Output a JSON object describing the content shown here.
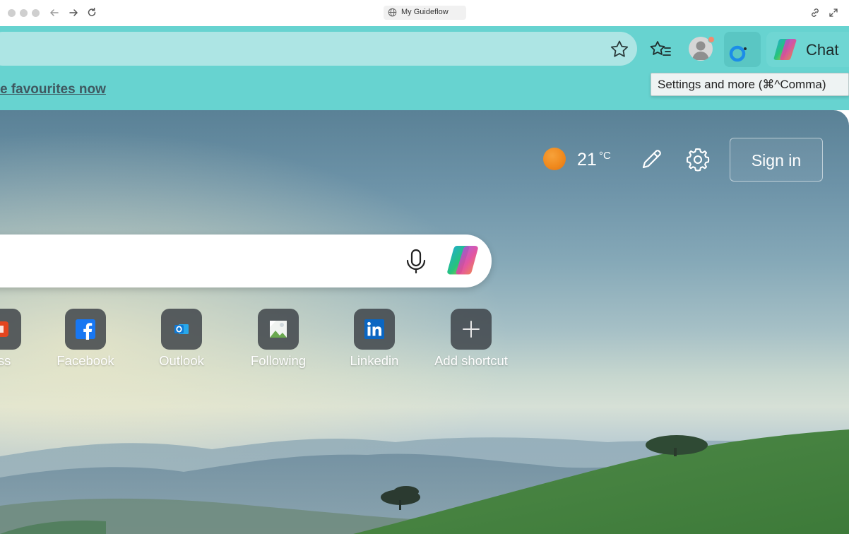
{
  "window": {
    "url_label": "My Guideflow"
  },
  "favourites_bar": {
    "link_text": "e favourites now"
  },
  "toolbar": {
    "chat_label": "Chat",
    "settings_tooltip": "Settings and more (⌘^Comma)"
  },
  "weather": {
    "temperature": "21",
    "unit": "°C"
  },
  "header": {
    "sign_in_label": "Sign in"
  },
  "shortcuts": [
    {
      "label": "ess",
      "icon": "office-icon"
    },
    {
      "label": "Facebook",
      "icon": "facebook-icon"
    },
    {
      "label": "Outlook",
      "icon": "outlook-icon"
    },
    {
      "label": "Following",
      "icon": "image-placeholder-icon"
    },
    {
      "label": "Linkedin",
      "icon": "linkedin-icon"
    },
    {
      "label": "Add shortcut",
      "icon": "plus-icon"
    }
  ],
  "colors": {
    "toolbar_bg": "#67d3d0",
    "address_bg": "#ade5e4",
    "facebook": "#1877f2",
    "linkedin": "#0a66c2",
    "outlook": "#0f78d4",
    "guide_ring": "#1c8de8"
  }
}
